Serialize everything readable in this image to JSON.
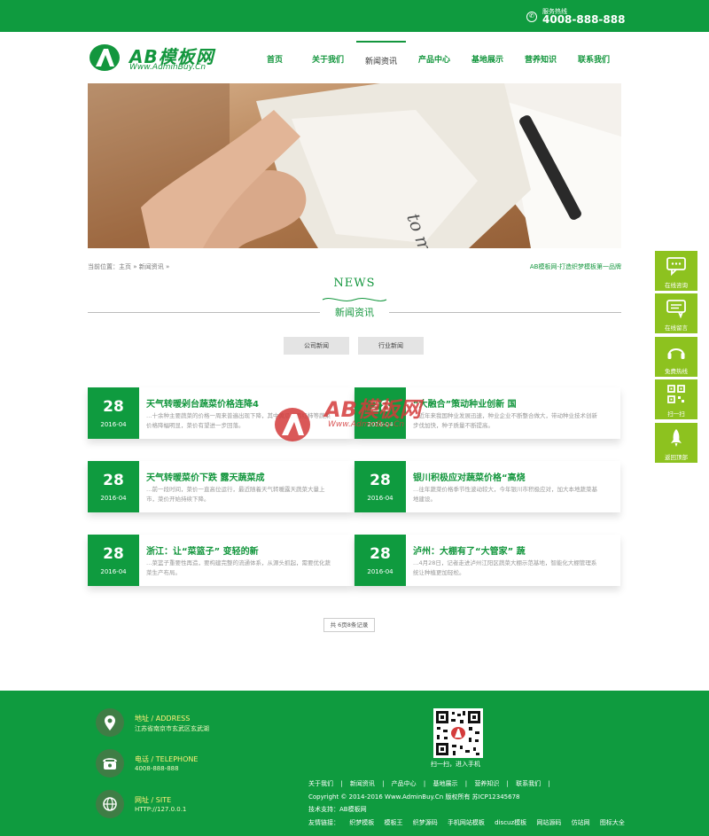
{
  "topbar": {
    "hotline_label": "服务热线",
    "hotline_number": "4008-888-888",
    "phone_icon": "phone-icon"
  },
  "logo": {
    "name": "AB模板网",
    "url": "Www.AdminBuy.Cn"
  },
  "nav": {
    "items": [
      "首页",
      "关于我们",
      "新闻资讯",
      "产品中心",
      "基地展示",
      "营养知识",
      "联系我们"
    ],
    "active": "新闻资讯"
  },
  "breadcrumb": "当前位置：主页 » 新闻资讯 »",
  "slogan": "AB模板网-打造织梦模板第一品牌",
  "section": {
    "en": "NEWS",
    "zh": "新闻资讯"
  },
  "tabs": [
    "公司新闻",
    "行业新闻"
  ],
  "news": [
    {
      "day": "28",
      "month": "2016-04",
      "title": "天气转暖剁台蔬菜价格连降4",
      "desc": "…十余种主要蔬菜的价格一周来普遍出现下降，其中黄瓜、西红柿等蔬菜价格降幅明显，菜价有望进一步回落。"
    },
    {
      "day": "28",
      "month": "2016-04",
      "title": "“大融合”策动种业创新 国",
      "desc": "…近年来我国种业发展迅速，种业企业不断整合做大，带动种业技术创新步伐加快，种子质量不断提高。"
    },
    {
      "day": "28",
      "month": "2016-04",
      "title": "天气转暖菜价下跌 露天蔬菜成",
      "desc": "…前一段时间，菜价一直高位运行，最近随着天气转暖露天蔬菜大量上市，菜价开始持续下降。"
    },
    {
      "day": "28",
      "month": "2016-04",
      "title": "银川积极应对蔬菜价格“高烧",
      "desc": "…往年蔬菜价格季节性波动较大，今年银川市积极应对，加大本地蔬菜基地建设。"
    },
    {
      "day": "28",
      "month": "2016-04",
      "title": "浙江：让“菜篮子” 变轻的新",
      "desc": "…菜篮子重要性再造，要构建完整的流通体系，从源头抓起，需要优化蔬菜生产布局。"
    },
    {
      "day": "28",
      "month": "2016-04",
      "title": "泸州：大棚有了“大管家” 蔬",
      "desc": "…4月28日，记者走进泸州江阳区蔬菜大棚示范基地，智能化大棚管理系统让种植更加轻松。"
    }
  ],
  "watermark": {
    "name": "AB模板网",
    "url": "Www.AdminBuy.Cn"
  },
  "pager": "共 6页8条记录",
  "sidebar": [
    {
      "label": "在线咨询",
      "icon": "chat-icon"
    },
    {
      "label": "在线留言",
      "icon": "message-icon"
    },
    {
      "label": "免费热线",
      "icon": "headset-icon"
    },
    {
      "label": "扫一扫",
      "icon": "qrcode-icon"
    },
    {
      "label": "返回顶部",
      "icon": "rocket-icon"
    }
  ],
  "footer": {
    "address_label": "地址 / ADDRESS",
    "address": "江苏省南京市玄武区玄武湖",
    "phone_label": "电话 / TELEPHONE",
    "phone": "4008-888-888",
    "site_label": "网址 / SITE",
    "site": "HTTP://127.0.0.1",
    "qr_caption": "扫一扫，进入手机",
    "links": [
      "关于我们",
      "|",
      "新闻资讯",
      "|",
      "产品中心",
      "|",
      "基地展示",
      "|",
      "营养知识",
      "|",
      "联系我们",
      "|"
    ],
    "copyright": "Copyright © 2014-2016 Www.AdminBuy.Cn 版权所有 苏ICP12345678",
    "support": "技术支持：AB模板网",
    "friends": [
      "友情链接：",
      "织梦模板",
      "模板王",
      "织梦源码",
      "手机网站模板",
      "discuz模板",
      "网站源码",
      "仿站网",
      "图标大全"
    ]
  }
}
